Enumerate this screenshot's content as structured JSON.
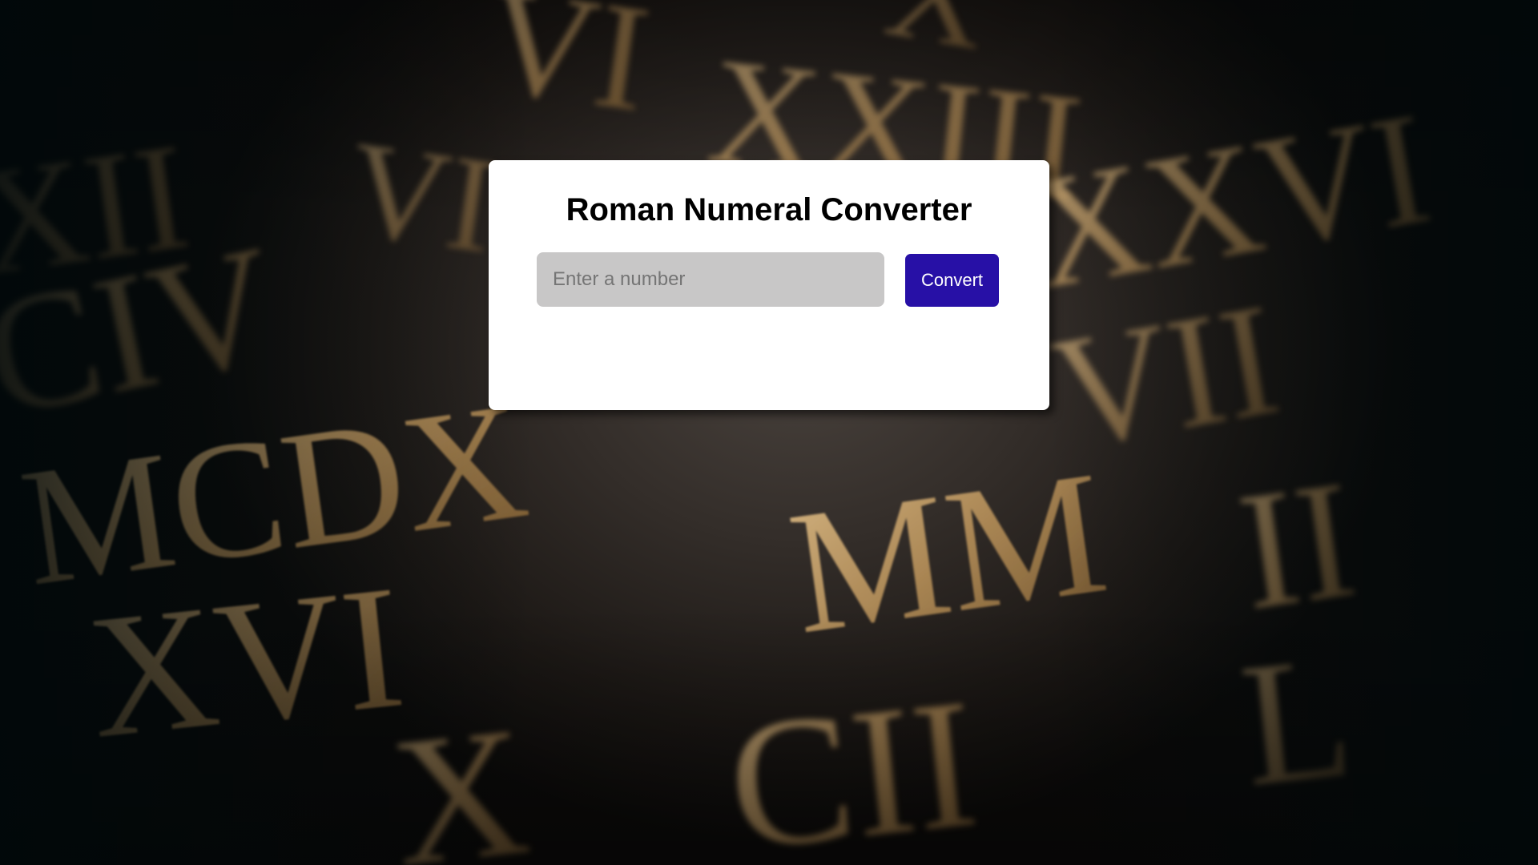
{
  "page": {
    "background": {
      "description_icon": "roman-numerals-background-image",
      "text_color": "#b8915a"
    }
  },
  "converter": {
    "title": "Roman Numeral Converter",
    "input": {
      "value": "",
      "placeholder": "Enter a number"
    },
    "button_label": "Convert",
    "output": ""
  },
  "colors": {
    "button_bg": "#2710a6",
    "input_bg": "#c8c7c7",
    "card_bg": "#ffffff"
  }
}
